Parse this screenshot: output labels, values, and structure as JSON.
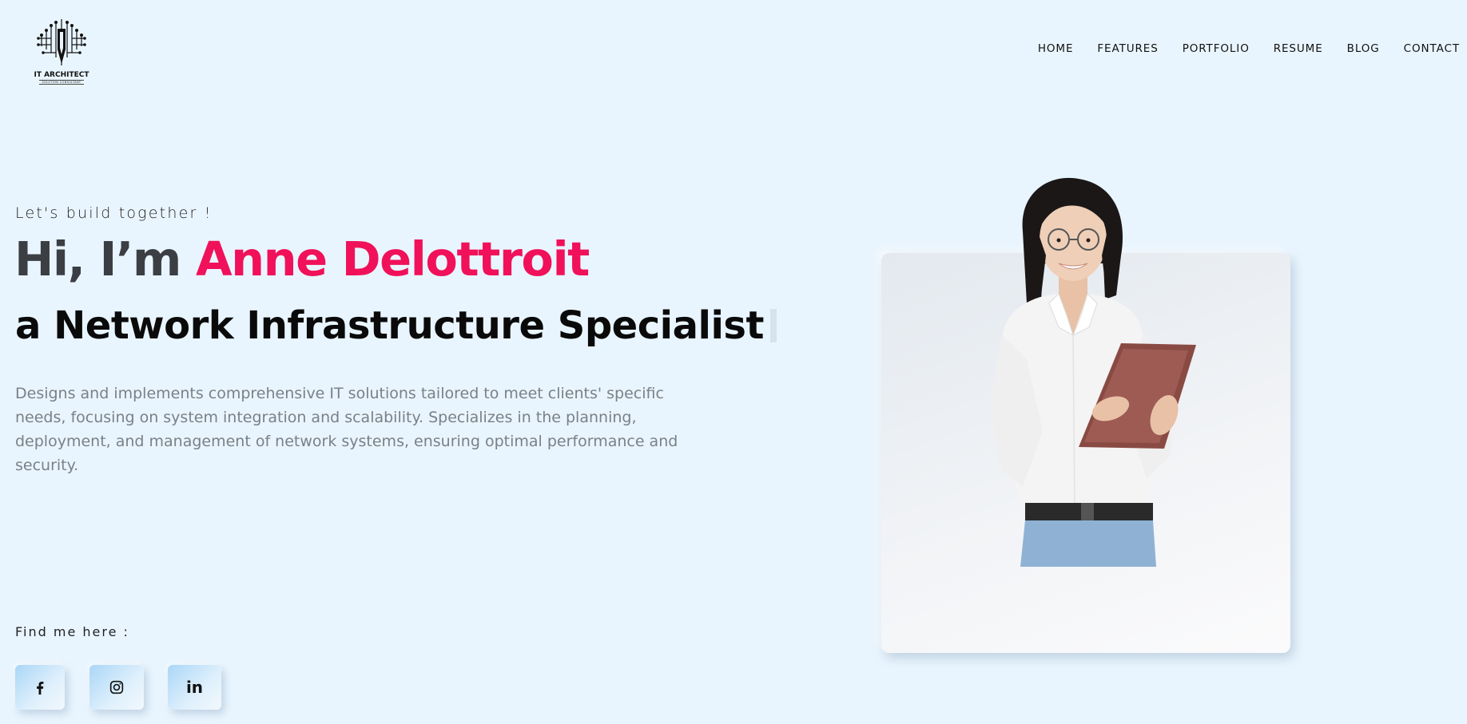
{
  "header": {
    "logo": {
      "title": "IT ARCHITECT",
      "subtitle": "SOLUTION CONSULTANT"
    },
    "nav": [
      "HOME",
      "FEATURES",
      "PORTFOLIO",
      "RESUME",
      "BLOG",
      "CONTACT"
    ]
  },
  "hero": {
    "tagline": "Let's build together !",
    "greeting": "Hi, I’m ",
    "name": "Anne Delottroit",
    "role": "a Network Infrastructure Specialist",
    "description": "Designs and implements comprehensive IT solutions tailored to meet clients' specific needs, focusing on system integration and scalability. Specializes in the planning, deployment, and management of network systems, ensuring optimal performance and security."
  },
  "social": {
    "label": "Find me here :",
    "links": [
      {
        "icon": "facebook-icon"
      },
      {
        "icon": "instagram-icon"
      },
      {
        "icon": "linkedin-icon",
        "glyph": "in"
      }
    ]
  },
  "colors": {
    "background": "#e9f5fe",
    "accent": "#f0115a",
    "heading": "#3b3e43",
    "body_text": "#7a8087"
  }
}
